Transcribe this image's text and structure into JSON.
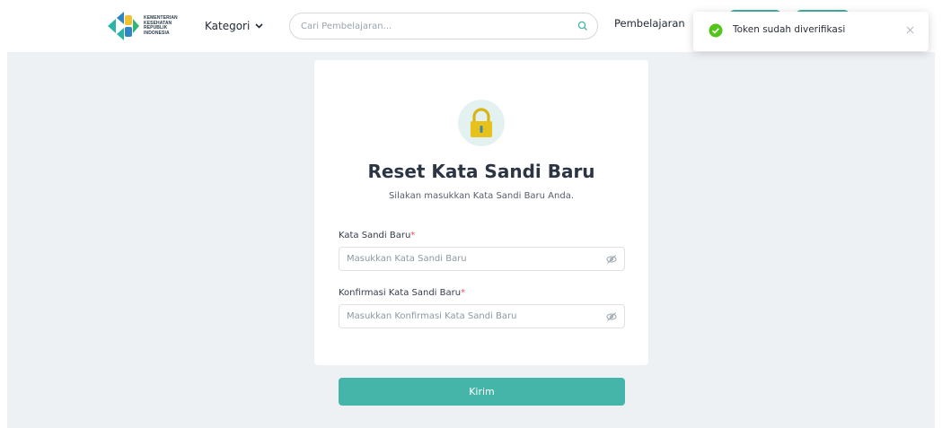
{
  "header": {
    "logo_lines": [
      "KEMENTERIAN",
      "KESEHATAN",
      "REPUBLIK",
      "INDONESIA"
    ],
    "kategori_label": "Kategori",
    "search_placeholder": "Cari Pembelajaran...",
    "pembelajaran_label": "Pembelajaran"
  },
  "card": {
    "icon": "lock-icon",
    "title": "Reset Kata Sandi Baru",
    "subtitle": "Silakan masukkan Kata Sandi Baru Anda.",
    "fields": [
      {
        "label": "Kata Sandi Baru",
        "required_mark": "*",
        "placeholder": "Masukkan Kata Sandi Baru",
        "value": ""
      },
      {
        "label": "Konfirmasi Kata Sandi Baru",
        "required_mark": "*",
        "placeholder": "Masukkan Konfirmasi Kata Sandi Baru",
        "value": ""
      }
    ]
  },
  "submit_label": "Kirim",
  "toast": {
    "message": "Token sudah diverifikasi",
    "icon": "check-circle-icon"
  },
  "colors": {
    "accent": "#45b5aa",
    "lock_body": "#e6c21a",
    "success": "#52c41a",
    "background": "#eef1f4"
  }
}
